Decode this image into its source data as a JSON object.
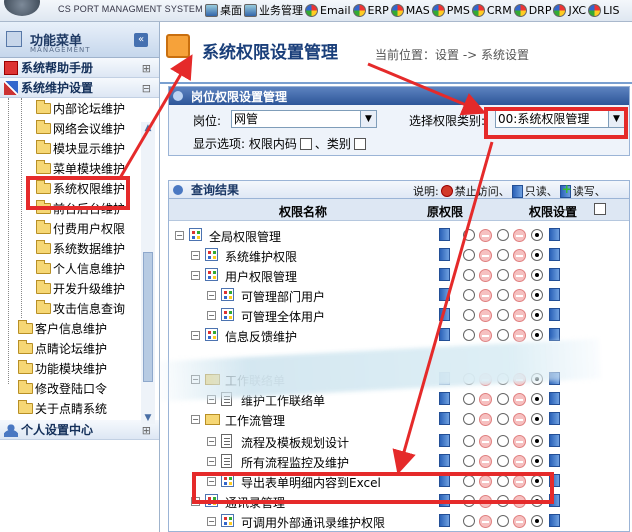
{
  "topbar": {
    "system_name": "CS PORT MANAGMENT SYSTEM",
    "nav": [
      "桌面",
      "业务管理",
      "Email",
      "ERP",
      "MAS",
      "PMS",
      "CRM",
      "DRP",
      "JXC",
      "LIS"
    ]
  },
  "sidebar": {
    "title": "功能菜单",
    "subtitle": "MANAGEMENT",
    "collapse_icon": "chevron-left-icon",
    "sections": {
      "help": "系统帮助手册",
      "maint": "系统维护设置",
      "personal": "个人设置中心"
    },
    "maint_children": [
      "内部论坛维护",
      "网络会议维护",
      "模块显示维护",
      "菜单模块维护",
      "系统权限维护",
      "前台后台维护",
      "付费用户权限",
      "系统数据维护",
      "个人信息维护",
      "开发升级维护",
      "攻击信息查询"
    ],
    "top_items": [
      "客户信息维护",
      "点睛论坛维护",
      "功能模块维护",
      "修改登陆口令",
      "关于点睛系统"
    ]
  },
  "main": {
    "title": "系统权限设置管理",
    "breadcrumb": "当前位置：设置 -> 系统设置",
    "filter_panel": {
      "header": "岗位权限设置管理",
      "position_label": "岗位:",
      "position_value": "网管",
      "category_label": "选择权限类别:",
      "category_value": "00:系统权限管理",
      "display_label": "显示选项: 权限内码",
      "category_option": "、类别"
    },
    "results": {
      "header": "查询结果",
      "legend_prefix": "说明:",
      "legend": [
        "禁止访问、",
        "只读、",
        "读写、"
      ],
      "columns": [
        "权限名称",
        "原权限",
        "权限设置"
      ],
      "rows": [
        {
          "name": "全局权限管理",
          "level": 0
        },
        {
          "name": "系统维护权限",
          "level": 1
        },
        {
          "name": "用户权限管理",
          "level": 1
        },
        {
          "name": "可管理部门用户",
          "level": 2
        },
        {
          "name": "可管理全体用户",
          "level": 2
        },
        {
          "name": "信息反馈维护",
          "level": 1
        },
        {
          "name": "工作联络单",
          "level": 1
        },
        {
          "name": "维护工作联络单",
          "level": 2
        },
        {
          "name": "工作流管理",
          "level": 1
        },
        {
          "name": "流程及模板规划设计",
          "level": 2
        },
        {
          "name": "所有流程监控及维护",
          "level": 2
        },
        {
          "name": "导出表单明细内容到Excel",
          "level": 2
        },
        {
          "name": "通讯录管理",
          "level": 1
        },
        {
          "name": "可调用外部通讯录维护权限",
          "level": 2
        }
      ]
    }
  },
  "colors": {
    "accent": "#2d5598",
    "highlight": "#e52a2a"
  }
}
